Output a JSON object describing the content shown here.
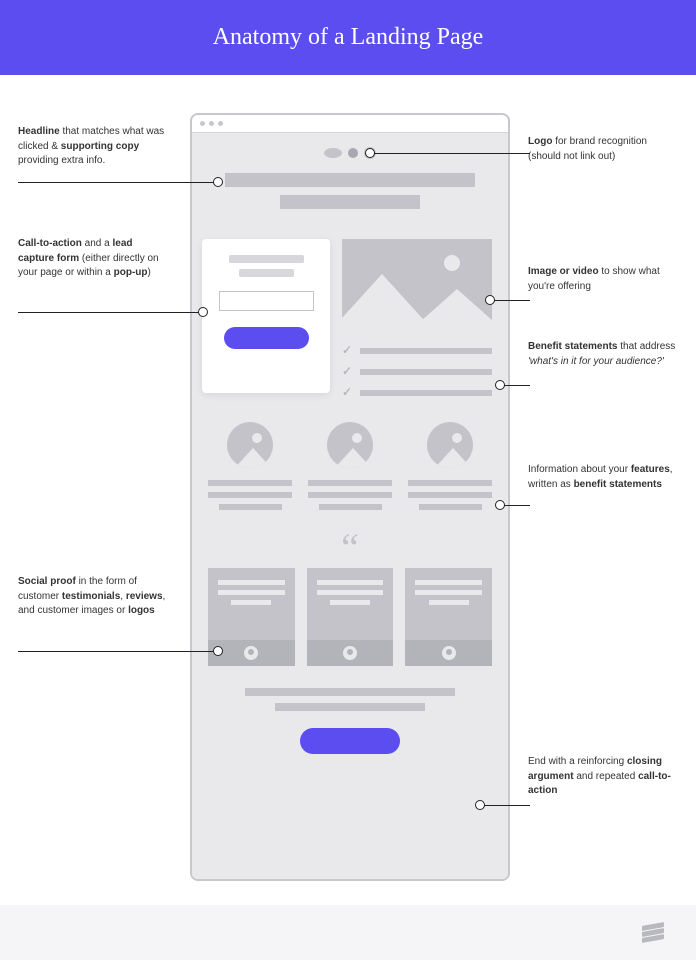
{
  "header": {
    "title": "Anatomy of a Landing Page"
  },
  "annotations": {
    "headline": "<b>Headline</b> that matches what was clicked & <b>supporting copy</b> providing extra info.",
    "cta": "<b>Call-to-action</b> and a <b>lead capture form</b> (either directly on your page or within a <b>pop-up</b>)",
    "social": "<b>Social proof</b> in the form of customer <b>testimonials</b>, <b>reviews</b>, and customer images or <b>logos</b>",
    "logo": "<b>Logo</b> for brand recognition (should not link out)",
    "image": "<b>Image or video</b> to show what you're offering",
    "benefit": "<b>Benefit statements</b> that address <i>'what's in it for your audience?'</i>",
    "features": "Information about your <b>features</b>, written as <b>benefit statements</b>",
    "closing": "End with a reinforcing <b>closing argument</b> and repeated <b>call-to-action</b>"
  }
}
